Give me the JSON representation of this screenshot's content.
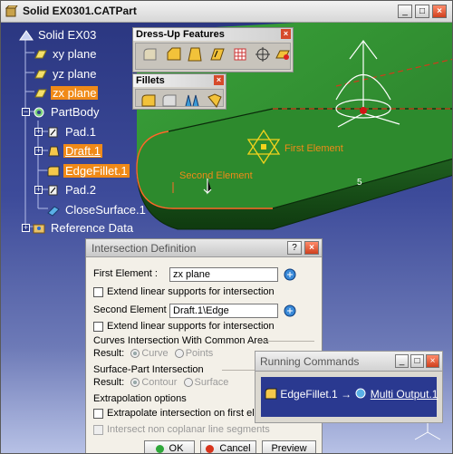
{
  "window": {
    "title": "Solid EX0301.CATPart",
    "buttons": {
      "minimize": "_",
      "maximize": "□",
      "close": "×"
    }
  },
  "tree": {
    "root": "Solid EX03",
    "planes": [
      "xy plane",
      "yz plane",
      "zx plane"
    ],
    "partbody": "PartBody",
    "features": [
      "Pad.1",
      "Draft.1",
      "EdgeFillet.1",
      "Pad.2",
      "CloseSurface.1"
    ],
    "reference": "Reference Data"
  },
  "viewport": {
    "label_first": "First Element",
    "label_second": "Second Element",
    "label_point": "5"
  },
  "toolbars": {
    "dressup": {
      "title": "Dress-Up Features"
    },
    "fillets": {
      "title": "Fillets"
    }
  },
  "dialog": {
    "title": "Intersection Definition",
    "first_label": "First Element :",
    "first_value": "zx plane",
    "extend1": "Extend linear supports for intersection",
    "second_label": "Second Element :",
    "second_value": "Draft.1\\Edge",
    "extend2": "Extend linear supports for intersection",
    "curves_group": "Curves Intersection With Common Area",
    "result_label": "Result:",
    "result_curve": "Curve",
    "result_points": "Points",
    "surface_group": "Surface-Part Intersection",
    "surface_result": "Result:",
    "surface_contour": "Contour",
    "surface_surface": "Surface",
    "extrap_group": "Extrapolation options",
    "extrap_first": "Extrapolate intersection on first element",
    "intersect_noncoplanar": "Intersect non coplanar line segments",
    "ok": "OK",
    "cancel": "Cancel",
    "preview": "Preview",
    "help": "?",
    "close": "×"
  },
  "running": {
    "title": "Running Commands",
    "cmd1": "EdgeFillet.1",
    "cmd2": "Multi Output.1",
    "separator": "→"
  },
  "colors": {
    "background_top": "#2b3781",
    "part_green": "#2f8a2f",
    "selection_orange": "#f08a18",
    "dialog_bg": "#f3f0e8"
  }
}
